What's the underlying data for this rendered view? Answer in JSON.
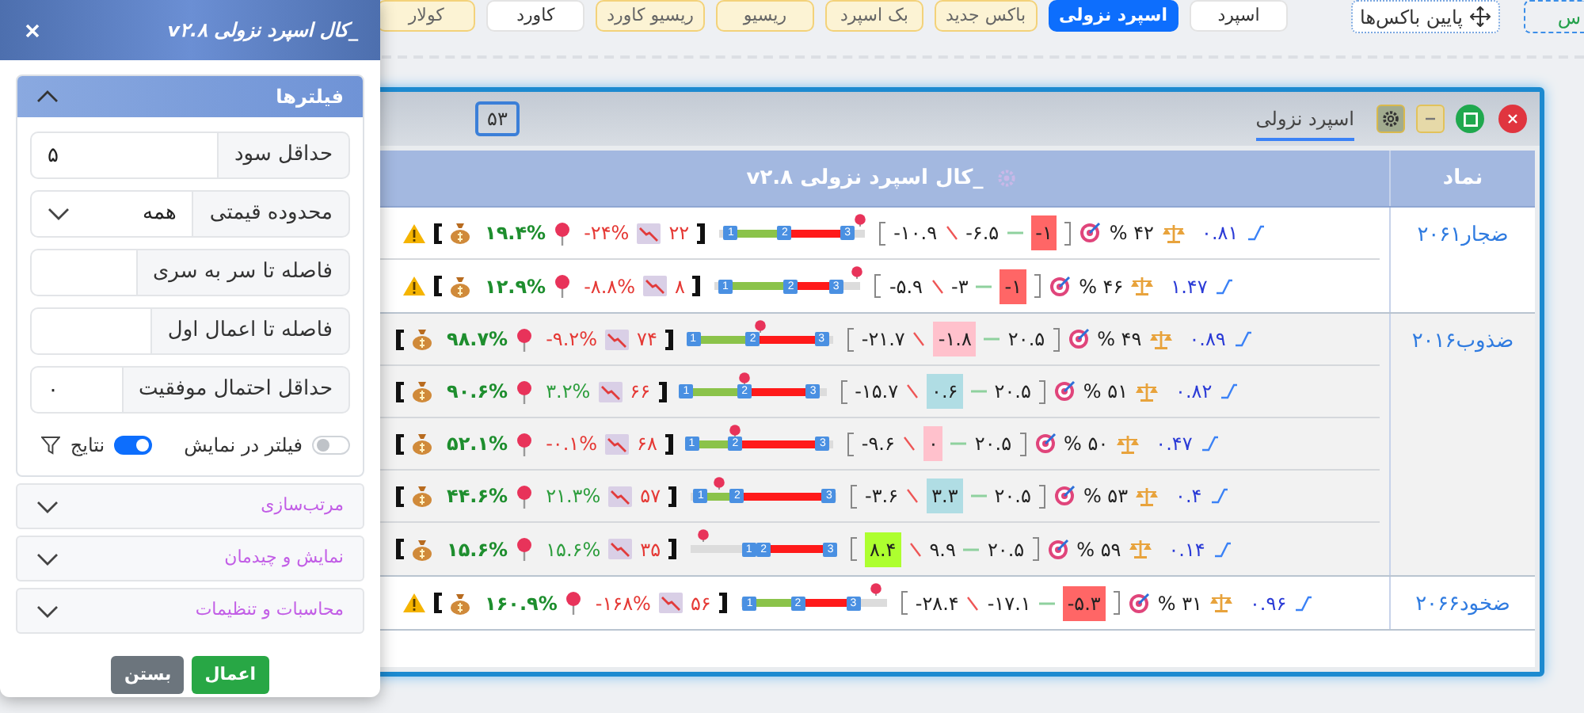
{
  "toolbar": {
    "edge_box": {
      "label": "س"
    },
    "layout_button": {
      "label": "پایین باکس‌ها"
    },
    "strategies": [
      {
        "label": "اسپرد",
        "kind": "plain",
        "selected": false
      },
      {
        "label": "اسپرد نزولی",
        "kind": "strategy",
        "selected": true
      },
      {
        "label": "باکس جدید",
        "kind": "strategy",
        "selected": false
      },
      {
        "label": "بک اسپرد",
        "kind": "strategy",
        "selected": false
      },
      {
        "label": "ریسیو",
        "kind": "strategy",
        "selected": false
      },
      {
        "label": "ریسیو کاورد",
        "kind": "strategy",
        "selected": false
      },
      {
        "label": "کاورد",
        "kind": "plain",
        "selected": false
      },
      {
        "label": "کولار",
        "kind": "strategy",
        "selected": false
      }
    ]
  },
  "window": {
    "tab": "اسپرد نزولی",
    "count": "۵۳"
  },
  "table": {
    "columns": [
      "نماد",
      "_کال اسپرد نزولی v۲.۸"
    ],
    "groups": [
      {
        "symbol": "ضجار۲۰۶۱",
        "rows": [
          {
            "ratio": "۰.۸۱",
            "probability": "۴۲ %",
            "levels": [
              {
                "text": "-۱",
                "color": "#ff6666"
              },
              {
                "text": "-۶.۵"
              },
              {
                "text": "-۱۰.۹"
              }
            ],
            "bar": {
              "markers": [
                {
                  "label": "3",
                  "level": 0.88
                },
                {
                  "label": "2",
                  "level": 0.45
                },
                {
                  "label": "1",
                  "level": 0.08
                }
              ],
              "pin": {
                "level": 0.97
              }
            },
            "count": "۲۲",
            "change": {
              "text": "-۲۴%",
              "negative": true
            },
            "return": "۱۹.۴%",
            "warning": true
          },
          {
            "ratio": "۱.۴۷",
            "probability": "۴۶ %",
            "levels": [
              {
                "text": "-۱",
                "color": "#ff6666"
              },
              {
                "text": "-۳"
              },
              {
                "text": "-۵.۹"
              }
            ],
            "bar": {
              "markers": [
                {
                  "label": "3",
                  "level": 0.83
                },
                {
                  "label": "2",
                  "level": 0.52
                },
                {
                  "label": "1",
                  "level": 0.07
                }
              ],
              "pin": {
                "level": 0.97
              }
            },
            "count": "۸",
            "change": {
              "text": "-۸.۸%",
              "negative": true
            },
            "return": "۱۲.۹%",
            "warning": true
          }
        ]
      },
      {
        "symbol": "ضذوب۲۰۱۶",
        "rows": [
          {
            "ratio": "۰.۸۹",
            "probability": "۴۹ %",
            "levels": [
              {
                "text": "۲۰.۵"
              },
              {
                "text": "-۱.۸",
                "color": "#ffc1cc"
              },
              {
                "text": "-۲۱.۷"
              }
            ],
            "bar": {
              "markers": [
                {
                  "label": "3",
                  "level": 0.92
                },
                {
                  "label": "2",
                  "level": 0.45
                },
                {
                  "label": "1",
                  "level": 0.04
                }
              ],
              "pin": {
                "level": 0.5
              }
            },
            "count": "۷۴",
            "change": {
              "text": "-۹.۲%",
              "negative": true
            },
            "return": "۹۸.۷%",
            "warning": false
          },
          {
            "ratio": "۰.۸۲",
            "probability": "۵۱ %",
            "levels": [
              {
                "text": "۲۰.۵"
              },
              {
                "text": "۰.۶",
                "color": "#b0dde4"
              },
              {
                "text": "-۱۵.۷"
              }
            ],
            "bar": {
              "markers": [
                {
                  "label": "3",
                  "level": 0.91
                },
                {
                  "label": "2",
                  "level": 0.44
                },
                {
                  "label": "1",
                  "level": 0.04
                }
              ],
              "pin": {
                "level": 0.44
              }
            },
            "count": "۶۶",
            "change": {
              "text": "۳.۲%",
              "negative": false
            },
            "return": "۹۰.۶%",
            "warning": false
          },
          {
            "ratio": "۰.۴۷",
            "probability": "۵۰ %",
            "levels": [
              {
                "text": "۲۰.۵"
              },
              {
                "text": "۰",
                "color": "#ffc1cc"
              },
              {
                "text": "-۹.۶"
              }
            ],
            "bar": {
              "markers": [
                {
                  "label": "3",
                  "level": 0.93
                },
                {
                  "label": "2",
                  "level": 0.33
                },
                {
                  "label": "1",
                  "level": 0.03
                }
              ],
              "pin": {
                "level": 0.33
              }
            },
            "count": "۶۸",
            "change": {
              "text": "-۰.۱%",
              "negative": true
            },
            "return": "۵۲.۱%",
            "warning": false
          },
          {
            "ratio": "۰.۴",
            "probability": "۵۳ %",
            "levels": [
              {
                "text": "۲۰.۵"
              },
              {
                "text": "۳.۳",
                "color": "#b0dde4"
              },
              {
                "text": "-۳.۶"
              }
            ],
            "bar": {
              "markers": [
                {
                  "label": "3",
                  "level": 0.95
                },
                {
                  "label": "2",
                  "level": 0.32
                },
                {
                  "label": "1",
                  "level": 0.07
                }
              ],
              "pin": {
                "level": 0.2
              }
            },
            "count": "۵۷",
            "change": {
              "text": "۲۱.۳%",
              "negative": false
            },
            "return": "۴۴.۶%",
            "warning": false
          },
          {
            "ratio": "۰.۱۴",
            "probability": "۵۹ %",
            "levels": [
              {
                "text": "۲۰.۵"
              },
              {
                "text": "۹.۹"
              },
              {
                "text": "۸.۴",
                "color": "#adff2f"
              }
            ],
            "bar": {
              "markers": [
                {
                  "label": "3",
                  "level": 0.96
                },
                {
                  "label": "2",
                  "level": 0.5
                },
                {
                  "label": "1",
                  "level": 0.4
                }
              ],
              "pin": {
                "level": 0.09
              }
            },
            "count": "۳۵",
            "change": {
              "text": "۱۵.۶%",
              "negative": false
            },
            "return": "۱۵.۶%",
            "warning": false
          }
        ]
      },
      {
        "symbol": "ضخود۲۰۶۶",
        "rows": [
          {
            "ratio": "۰.۹۶",
            "probability": "۳۱ %",
            "levels": [
              {
                "text": "-۵.۳",
                "color": "#ff6666"
              },
              {
                "text": "-۱۷.۱"
              },
              {
                "text": "-۲۸.۴"
              }
            ],
            "bar": {
              "markers": [
                {
                  "label": "3",
                  "level": 0.77
                },
                {
                  "label": "2",
                  "level": 0.39
                },
                {
                  "label": "1",
                  "level": 0.06
                }
              ],
              "pin": {
                "level": 0.93
              }
            },
            "count": "۵۶",
            "change": {
              "text": "-۱۶۸%",
              "negative": true
            },
            "return": "۱۶۰.۹%",
            "warning": true
          }
        ]
      }
    ]
  },
  "dialog": {
    "title": "_کال اسپرد نزولی v۲.۸",
    "filters": {
      "title": "فیلترها",
      "expanded": true,
      "fields": [
        {
          "label": "حداقل سود",
          "kind": "input",
          "value": "۵"
        },
        {
          "label": "محدوده قیمتی",
          "kind": "select",
          "value": "همه"
        },
        {
          "label": "فاصله تا سر به سری",
          "kind": "input"
        },
        {
          "label": "فاصله تا اعمال اول",
          "kind": "input"
        },
        {
          "label": "حداقل احتمال موفقیت",
          "kind": "input",
          "value": "۰"
        }
      ],
      "switches": [
        {
          "label": "فیلتر در نمایش",
          "on": false
        },
        {
          "label": "نتایج",
          "on": true
        }
      ]
    },
    "sections": [
      {
        "title": "مرتب‌سازی",
        "expanded": false
      },
      {
        "title": "نمایش و چیدمان",
        "expanded": false
      },
      {
        "title": "محاسبات و تنظیمات",
        "expanded": false
      }
    ],
    "buttons": [
      {
        "label": "اعمال",
        "kind": "primary"
      },
      {
        "label": "بستن",
        "kind": "secondary"
      }
    ]
  }
}
